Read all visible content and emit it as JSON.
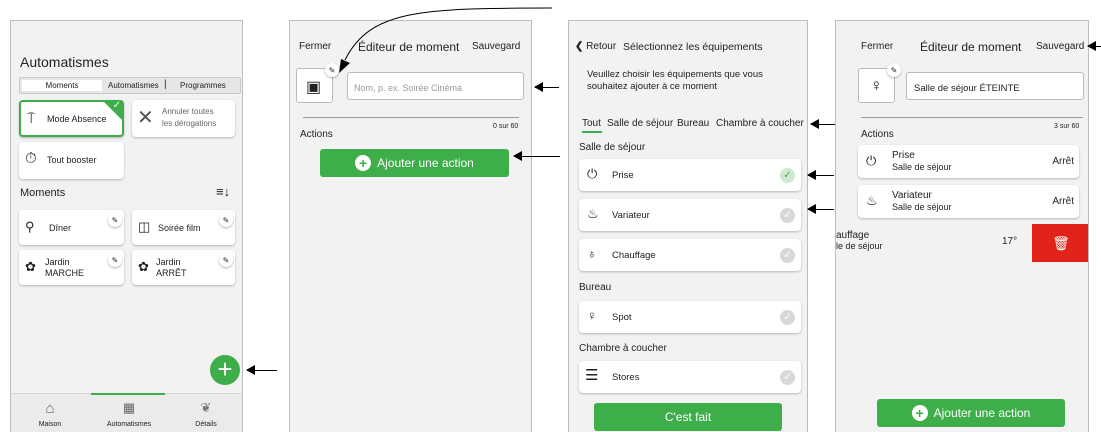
{
  "screen1": {
    "title": "Automatismes",
    "tabs": [
      "Moments",
      "Automatismes",
      "|",
      "Programmes"
    ],
    "mode_absence": "Mode Absence",
    "annuler": [
      "Annuler toutes",
      "les dérogations"
    ],
    "tout_booster": "Tout booster",
    "moments_header": "Moments",
    "moments": [
      {
        "label": "Dîner"
      },
      {
        "label": "Soirée film"
      },
      {
        "label": "Jardin\nMARCHE",
        "l1": "Jardin",
        "l2": "MARCHE"
      },
      {
        "label": "Jardin\nARRÊT",
        "l1": "Jardin",
        "l2": "ARRÊT"
      }
    ],
    "nav": [
      "Maison",
      "Automatismes",
      "Détails"
    ]
  },
  "screen2": {
    "close": "Fermer",
    "title": "Éditeur de moment",
    "save": "Sauvegard",
    "name_placeholder": "Nom, p. ex. Soirée Cinéma",
    "actions_label": "Actions",
    "count": "0 sur 60",
    "add_action": "Ajouter une action"
  },
  "screen3": {
    "back": "Retour",
    "title": "Sélectionnez les équipements",
    "instructions": "Veuillez choisir les équipements que vous souhaitez ajouter à ce moment",
    "tabs": [
      "Tout",
      "Salle de séjour",
      "Bureau",
      "Chambre à coucher"
    ],
    "groups": [
      {
        "name": "Salle de séjour",
        "items": [
          "Prise",
          "Variateur",
          "Chauffage"
        ]
      },
      {
        "name": "Bureau",
        "items": [
          "Spot"
        ]
      },
      {
        "name": "Chambre à coucher",
        "items": [
          "Stores"
        ]
      }
    ],
    "done": "C'est fait"
  },
  "screen4": {
    "close": "Fermer",
    "title": "Éditeur de moment",
    "save": "Sauvegard",
    "name_value": "Salle de séjour ÉTEINTE",
    "actions_label": "Actions",
    "count": "3 sur 60",
    "actions": [
      {
        "name": "Prise",
        "room": "Salle de séjour",
        "value": "Arrêt"
      },
      {
        "name": "Variateur",
        "room": "Salle de séjour",
        "value": "Arrêt"
      },
      {
        "name": "auffage",
        "room": "le de séjour",
        "value": "17°"
      }
    ],
    "add_action": "Ajouter une action"
  },
  "colors": {
    "accent": "#3dae49",
    "delete": "#e2231a"
  }
}
